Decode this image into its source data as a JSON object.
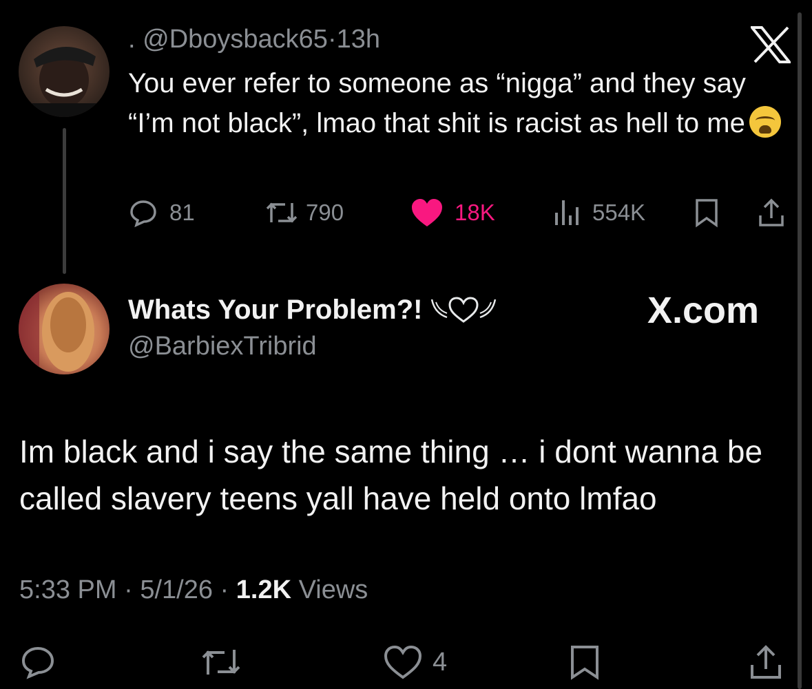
{
  "tweet1": {
    "display_name": ".",
    "handle": "@Dboysback65",
    "separator": "·",
    "time": "13h",
    "text": "You ever refer to someone as “nigga” and they say “I’m not black”, lmao that shit is racist as hell to me",
    "emoji": "loudly-crying-face",
    "stats": {
      "replies": "81",
      "reposts": "790",
      "likes": "18K",
      "views": "554K"
    }
  },
  "tweet2": {
    "display_name": "Whats Your Problem?!",
    "handle": "@BarbiexTribrid",
    "text": "Im black and i say the same thing … i dont wanna be called slavery teens yall have held onto lmfao",
    "time": "5:33 PM",
    "date": "5/1/26",
    "sep": "·",
    "views_count": "1.2K",
    "views_label": "Views",
    "likes": "4"
  },
  "watermark": "X.com",
  "colors": {
    "background": "#000000",
    "text": "#f2f2f2",
    "muted": "#8b8f94",
    "like": "#f91880"
  },
  "icons": [
    "x-logo-icon",
    "reply-icon",
    "repost-icon",
    "heart-filled-icon",
    "views-icon",
    "bookmark-icon",
    "share-icon",
    "heart-outline-icon",
    "winged-heart-icon"
  ]
}
